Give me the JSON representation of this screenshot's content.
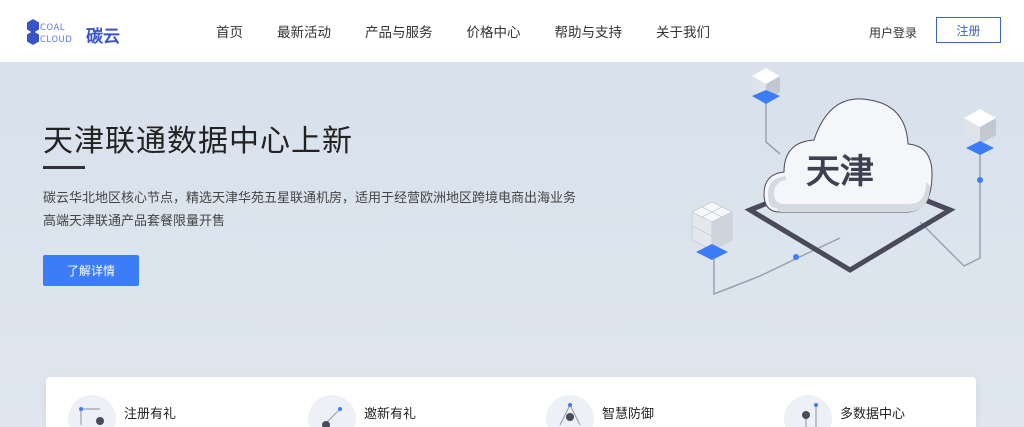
{
  "brand": {
    "logo_alt": "COAL CLOUD",
    "name": "碳云"
  },
  "nav": {
    "items": [
      "首页",
      "最新活动",
      "产品与服务",
      "价格中心",
      "帮助与支持",
      "关于我们"
    ],
    "login_label": "用户登录",
    "register_label": "注册"
  },
  "hero": {
    "title": "天津联通数据中心上新",
    "desc_line1": "碳云华北地区核心节点，精选天津华苑五星联通机房，适用于经营欧洲地区跨境电商出海业务",
    "desc_line2": "高端天津联通产品套餐限量开售",
    "cta_label": "了解详情",
    "illustration_text": "天津"
  },
  "features": [
    {
      "label": "注册有礼",
      "icon": "network-node-icon"
    },
    {
      "label": "邀新有礼",
      "icon": "share-node-icon"
    },
    {
      "label": "智慧防御",
      "icon": "shield-node-icon"
    },
    {
      "label": "多数据中心",
      "icon": "datacenter-node-icon"
    }
  ],
  "colors": {
    "accent": "#3d7cf7",
    "brand": "#3a54c8",
    "hero_bg": "#dfe6ef"
  }
}
